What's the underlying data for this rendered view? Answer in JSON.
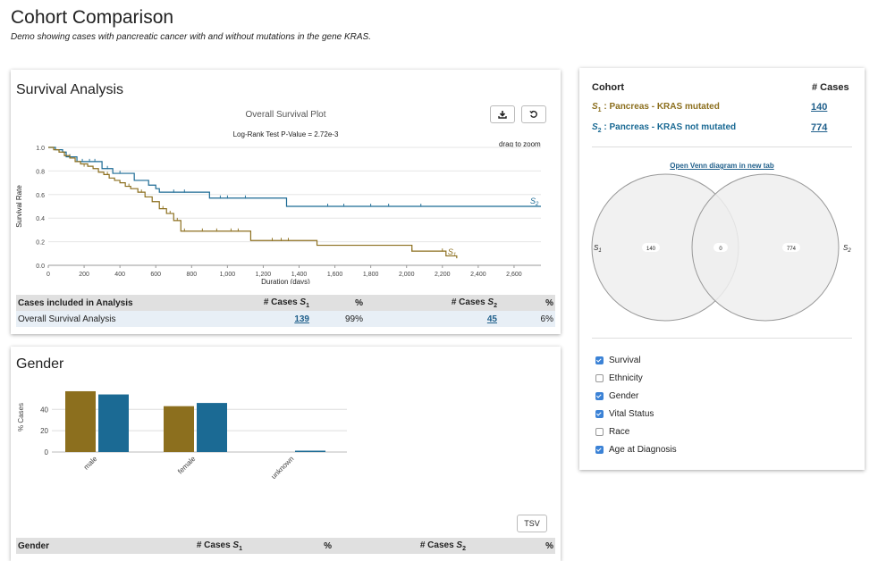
{
  "header": {
    "title": "Cohort Comparison",
    "subtitle": "Demo showing cases with pancreatic cancer with and without mutations in the gene KRAS."
  },
  "colors": {
    "s1": "#8c6f1e",
    "s2": "#1b6a94",
    "link": "#1f5f8b"
  },
  "survival": {
    "title": "Survival Analysis",
    "plot_title": "Overall Survival Plot",
    "pvalue_text": "Log-Rank Test P-Value = 2.72e-3",
    "drag_hint": "drag to zoom",
    "download_icon": "download-icon",
    "reset_icon": "reset-icon",
    "table": {
      "headers": [
        "Cases included in Analysis",
        "# Cases S1",
        "%",
        "# Cases S2",
        "%"
      ],
      "row_label": "Overall Survival Analysis",
      "s1_count": "139",
      "s1_pct": "99%",
      "s2_count": "45",
      "s2_pct": "6%"
    }
  },
  "chart_data": [
    {
      "type": "line",
      "title": "Overall Survival Plot",
      "xlabel": "Duration (days)",
      "ylabel": "Survival Rate",
      "xlim": [
        0,
        2750
      ],
      "ylim": [
        0,
        1.0
      ],
      "x_ticks": [
        "0",
        "200",
        "400",
        "600",
        "800",
        "1,000",
        "1,200",
        "1,400",
        "1,600",
        "1,800",
        "2,000",
        "2,200",
        "2,400",
        "2,600"
      ],
      "y_ticks": [
        "0.0",
        "0.2",
        "0.4",
        "0.6",
        "0.8",
        "1.0"
      ],
      "series": [
        {
          "name": "S2",
          "step_points": [
            [
              0,
              1.0
            ],
            [
              40,
              0.98
            ],
            [
              80,
              0.96
            ],
            [
              100,
              0.92
            ],
            [
              160,
              0.88
            ],
            [
              300,
              0.82
            ],
            [
              360,
              0.78
            ],
            [
              480,
              0.72
            ],
            [
              560,
              0.68
            ],
            [
              600,
              0.65
            ],
            [
              620,
              0.62
            ],
            [
              900,
              0.57
            ],
            [
              1330,
              0.5
            ],
            [
              2750,
              0.5
            ]
          ],
          "censored": [
            [
              120,
              0.92
            ],
            [
              190,
              0.88
            ],
            [
              230,
              0.88
            ],
            [
              260,
              0.88
            ],
            [
              330,
              0.82
            ],
            [
              400,
              0.78
            ],
            [
              700,
              0.62
            ],
            [
              760,
              0.62
            ],
            [
              960,
              0.57
            ],
            [
              1000,
              0.57
            ],
            [
              1100,
              0.57
            ],
            [
              1560,
              0.5
            ],
            [
              1650,
              0.5
            ],
            [
              1800,
              0.5
            ],
            [
              1900,
              0.5
            ],
            [
              2080,
              0.5
            ]
          ]
        },
        {
          "name": "S1",
          "step_points": [
            [
              0,
              1.0
            ],
            [
              30,
              0.98
            ],
            [
              60,
              0.96
            ],
            [
              90,
              0.93
            ],
            [
              120,
              0.91
            ],
            [
              150,
              0.88
            ],
            [
              180,
              0.86
            ],
            [
              220,
              0.84
            ],
            [
              250,
              0.82
            ],
            [
              280,
              0.79
            ],
            [
              310,
              0.77
            ],
            [
              340,
              0.74
            ],
            [
              370,
              0.72
            ],
            [
              400,
              0.7
            ],
            [
              430,
              0.67
            ],
            [
              460,
              0.65
            ],
            [
              500,
              0.62
            ],
            [
              540,
              0.58
            ],
            [
              580,
              0.54
            ],
            [
              620,
              0.48
            ],
            [
              660,
              0.44
            ],
            [
              700,
              0.38
            ],
            [
              740,
              0.29
            ],
            [
              1130,
              0.21
            ],
            [
              1500,
              0.17
            ],
            [
              2030,
              0.12
            ],
            [
              2220,
              0.08
            ],
            [
              2280,
              0.06
            ]
          ],
          "censored": [
            [
              200,
              0.84
            ],
            [
              330,
              0.77
            ],
            [
              450,
              0.67
            ],
            [
              520,
              0.62
            ],
            [
              640,
              0.48
            ],
            [
              680,
              0.44
            ],
            [
              720,
              0.38
            ],
            [
              760,
              0.29
            ],
            [
              860,
              0.29
            ],
            [
              940,
              0.29
            ],
            [
              1020,
              0.29
            ],
            [
              1060,
              0.29
            ],
            [
              1250,
              0.21
            ],
            [
              1300,
              0.21
            ],
            [
              1340,
              0.21
            ],
            [
              2030,
              0.12
            ],
            [
              2200,
              0.12
            ]
          ]
        }
      ]
    },
    {
      "type": "bar",
      "title": "Gender",
      "xlabel": "",
      "ylabel": "% Cases",
      "ylim": [
        0,
        62
      ],
      "y_ticks": [
        "0",
        "20",
        "40"
      ],
      "categories": [
        "male",
        "female",
        "unknown"
      ],
      "series": [
        {
          "name": "S1",
          "values": [
            57,
            43,
            0
          ]
        },
        {
          "name": "S2",
          "values": [
            54,
            46,
            1
          ]
        }
      ]
    }
  ],
  "gender": {
    "title": "Gender",
    "tsv_label": "TSV",
    "table_headers": [
      "Gender",
      "# Cases S1",
      "%",
      "# Cases S2",
      "%"
    ]
  },
  "cohort": {
    "header_cohort": "Cohort",
    "header_cases": "# Cases",
    "s1_sym": "S",
    "s1_sub": "1",
    "s1_name": " : Pancreas - KRAS mutated",
    "s1_count": "140",
    "s2_sym": "S",
    "s2_sub": "2",
    "s2_name": " : Pancreas - KRAS not mutated",
    "s2_count": "774",
    "venn_link": "Open Venn diagram in new tab",
    "venn": {
      "s1_only": "140",
      "both": "0",
      "s2_only": "774"
    },
    "facets": [
      {
        "label": "Survival",
        "checked": true
      },
      {
        "label": "Ethnicity",
        "checked": false
      },
      {
        "label": "Gender",
        "checked": true
      },
      {
        "label": "Vital Status",
        "checked": true
      },
      {
        "label": "Race",
        "checked": false
      },
      {
        "label": "Age at Diagnosis",
        "checked": true
      }
    ]
  }
}
